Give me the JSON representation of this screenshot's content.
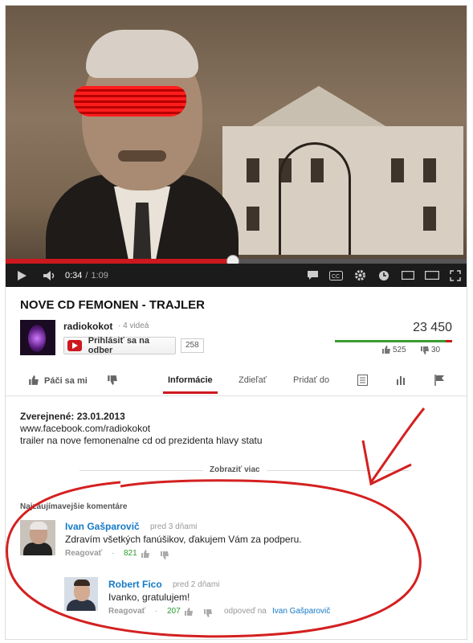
{
  "video": {
    "current_time": "0:34",
    "duration": "1:09",
    "progress_fraction": 0.493
  },
  "title": "NOVE CD FEMONEN - TRAJLER",
  "channel": {
    "name": "radiokokot",
    "videos": "· 4 videá",
    "subscribe_label": "Prihlásiť sa na odber",
    "subscriber_count": "258"
  },
  "stats": {
    "views": "23 450",
    "likes": "525",
    "dislikes": "30"
  },
  "tabs": {
    "like_label": "Páči sa mi",
    "info": "Informácie",
    "share": "Zdieľať",
    "add_to": "Pridať do"
  },
  "description": {
    "published_label": "Zverejnené: 23.01.2013",
    "link": "www.facebook.com/radiokokot",
    "text": "trailer na nove femonenalne cd od prezidenta hlavy statu",
    "show_more": "Zobraziť viac"
  },
  "comments": {
    "header": "Najzaujímavejšie komentáre",
    "items": [
      {
        "author": "Ivan Gašparovič",
        "time": "pred 3 dňami",
        "text": "Zdravím všetkých fanúšikov, ďakujem Vám za podperu.",
        "reply_label": "Reagovať",
        "likes": "821"
      },
      {
        "author": "Robert Fico",
        "time": "pred 2 dňami",
        "text": "Ivanko, gratulujem!",
        "reply_label": "Reagovať",
        "likes": "207",
        "in_reply_prefix": "odpoveď na",
        "in_reply_to": "Ivan Gašparovič"
      }
    ]
  },
  "colors": {
    "accent_red": "#cc181e",
    "link_blue": "#167ac6",
    "like_green": "#2b9b2b",
    "annotation_red": "#d42020"
  }
}
